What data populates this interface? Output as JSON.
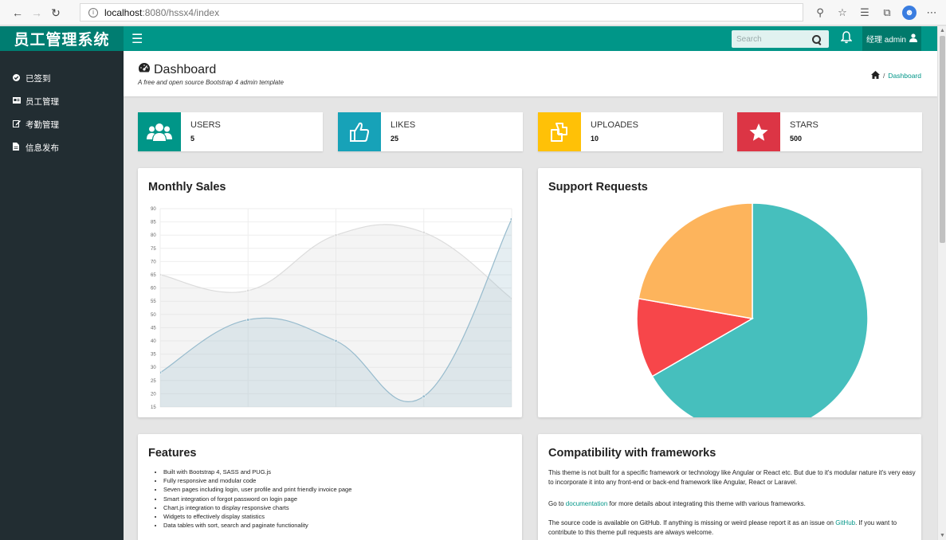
{
  "browser": {
    "url_host": "localhost",
    "url_path": ":8080/hssx4/index"
  },
  "header": {
    "brand": "员工管理系统",
    "search_placeholder": "Search",
    "user_label": "经理 admin"
  },
  "sidebar": {
    "items": [
      {
        "label": "已签到",
        "icon": "check-circle-icon"
      },
      {
        "label": "员工管理",
        "icon": "id-card-icon"
      },
      {
        "label": "考勤管理",
        "icon": "edit-icon"
      },
      {
        "label": "信息发布",
        "icon": "file-icon"
      }
    ]
  },
  "page": {
    "title": "Dashboard",
    "subtitle": "A free and open source Bootstrap 4 admin template",
    "breadcrumb_current": "Dashboard"
  },
  "widgets": [
    {
      "label": "USERS",
      "value": "5",
      "color": "#009688",
      "icon": "users-icon"
    },
    {
      "label": "LIKES",
      "value": "25",
      "color": "#17a2b8",
      "icon": "thumbs-up-icon"
    },
    {
      "label": "UPLOADES",
      "value": "10",
      "color": "#ffc107",
      "icon": "files-icon"
    },
    {
      "label": "STARS",
      "value": "500",
      "color": "#dc3545",
      "icon": "star-icon"
    }
  ],
  "monthly_sales": {
    "title": "Monthly Sales"
  },
  "support_requests": {
    "title": "Support Requests"
  },
  "chart_data": [
    {
      "type": "line",
      "title": "Monthly Sales",
      "x": [
        0,
        1,
        2,
        3,
        4
      ],
      "ylim": [
        15,
        90
      ],
      "yticks": [
        15,
        20,
        25,
        30,
        35,
        40,
        45,
        50,
        55,
        60,
        65,
        70,
        75,
        80,
        85,
        90
      ],
      "grid": true,
      "series": [
        {
          "values": [
            65,
            59,
            80,
            81,
            56
          ],
          "color": "#dcdcdc"
        },
        {
          "values": [
            28,
            48,
            40,
            19,
            86
          ],
          "color": "#97bbcd"
        }
      ]
    },
    {
      "type": "pie",
      "title": "Support Requests",
      "values": [
        300,
        50,
        100
      ],
      "colors": [
        "#46BFBD",
        "#F7464A",
        "#FDB45C"
      ]
    }
  ],
  "features": {
    "title": "Features",
    "items": [
      "Built with Bootstrap 4, SASS and PUG.js",
      "Fully responsive and modular code",
      "Seven pages including login, user profile and print friendly invoice page",
      "Smart integration of forgot password on login page",
      "Chart.js integration to display responsive charts",
      "Widgets to effectively display statistics",
      "Data tables with sort, search and paginate functionality"
    ]
  },
  "compat": {
    "title": "Compatibility with frameworks",
    "p1": "This theme is not built for a specific framework or technology like Angular or React etc. But due to it's modular nature it's very easy to incorporate it into any front-end or back-end framework like Angular, React or Laravel.",
    "p2_pre": "Go to ",
    "p2_link": "documentation",
    "p2_post": " for more details about integrating this theme with various frameworks.",
    "p3_pre": "The source code is available on GitHub. If anything is missing or weird please report it as an issue on ",
    "p3_link": "GitHub",
    "p3_post": ". If you want to contribute to this theme pull requests are always welcome."
  }
}
